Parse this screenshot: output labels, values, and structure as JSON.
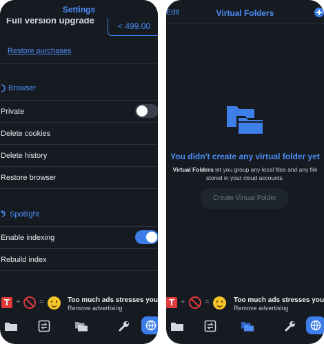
{
  "settings": {
    "title": "Settings",
    "upgrade_label": "Full version upgrade",
    "upgrade_price": "< 499.00",
    "restore_purchases": "Restore purchases",
    "browser_section": "Browser",
    "private_label": "Private",
    "private_enabled": false,
    "delete_cookies": "Delete cookies",
    "delete_history": "Delete history",
    "restore_browser": "Restore browser",
    "spotlight_section": "Spotlight",
    "enable_indexing": "Enable indexing",
    "indexing_enabled": true,
    "rebuild_index": "Rebuild index"
  },
  "virtual_folders": {
    "title": "Virtual Folders",
    "edit_label": "Edit",
    "empty_title": "You didn't create any virtual folder yet",
    "desc_bold": "Virtual Folders",
    "desc_rest": " let you group any local files and any file stored in your cloud accounts.",
    "create_button": "Create Virtual Folder"
  },
  "ad": {
    "title": "Too much ads stresses you?",
    "subtitle": "Remove advertising",
    "plus": "+",
    "equals": "="
  },
  "colors": {
    "accent": "#3d7ee8",
    "background": "#161b22",
    "ad_red": "#e23b3b",
    "smiley": "#f6c42b"
  },
  "tabbar_icons": [
    "folder-icon",
    "transfer-icon",
    "virtual-folders-icon",
    "wrench-icon",
    "browser-globe-icon"
  ]
}
